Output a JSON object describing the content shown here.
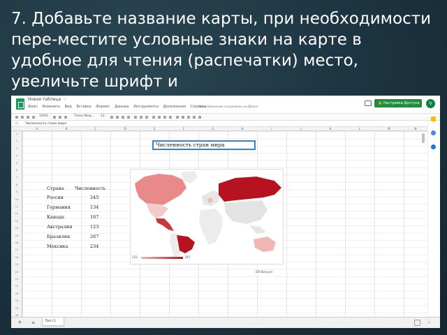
{
  "slide": {
    "title": "7. Добавьте название карты, при необходимости пере-местите условные знаки на карте  в удобное для чтения (распечатки) место, увеличьте шрифт и"
  },
  "sheets": {
    "doc_title": "Новая таблица",
    "menu": [
      "Файл",
      "Изменить",
      "Вид",
      "Вставка",
      "Формат",
      "Данные",
      "Инструменты",
      "Дополнения",
      "Справка"
    ],
    "saved_status": "Все изменения сохранены на Диске",
    "share_label": "Настройки Доступа",
    "user_initial": "V",
    "toolbar": {
      "zoom": "100%",
      "font": "Times New...",
      "size": "12"
    },
    "formula_bar": {
      "fx": "fx",
      "content": "Численность стран мира"
    },
    "columns": [
      "A",
      "B",
      "C",
      "D",
      "E",
      "F",
      "G",
      "H",
      "I",
      "J",
      "K",
      "L",
      "M",
      "N"
    ],
    "rows": [
      "1",
      "2",
      "3",
      "4",
      "5",
      "6",
      "7",
      "8",
      "9",
      "10",
      "11",
      "12",
      "13",
      "14",
      "15",
      "16",
      "17",
      "18",
      "19",
      "20",
      "21",
      "22",
      "23",
      "24",
      "25",
      "26"
    ],
    "table": {
      "header_country": "Страна",
      "header_population": "Численность",
      "rows": [
        {
          "country": "Россия",
          "value": "245"
        },
        {
          "country": "Германия",
          "value": "134"
        },
        {
          "country": "Канада",
          "value": "167"
        },
        {
          "country": "Австралия",
          "value": "123"
        },
        {
          "country": "Бразилия",
          "value": "267"
        },
        {
          "country": "Мексика",
          "value": "234"
        }
      ]
    },
    "chart": {
      "title": "Численность стран мира",
      "legend_min": "123",
      "legend_max": "267",
      "source_label": "ЕЯ Визуал"
    },
    "sheet_tab": "Лист1",
    "add_sheet": "+",
    "sheet_list": "≡",
    "nav_arrow": "›",
    "colors": {
      "brand_green": "#0f9d58",
      "share_green": "#1e8e3e",
      "map_dark": "#b7121f",
      "map_light": "#e88a8a",
      "map_mid": "#c9373f",
      "selection_blue": "#3b7ddd"
    }
  }
}
